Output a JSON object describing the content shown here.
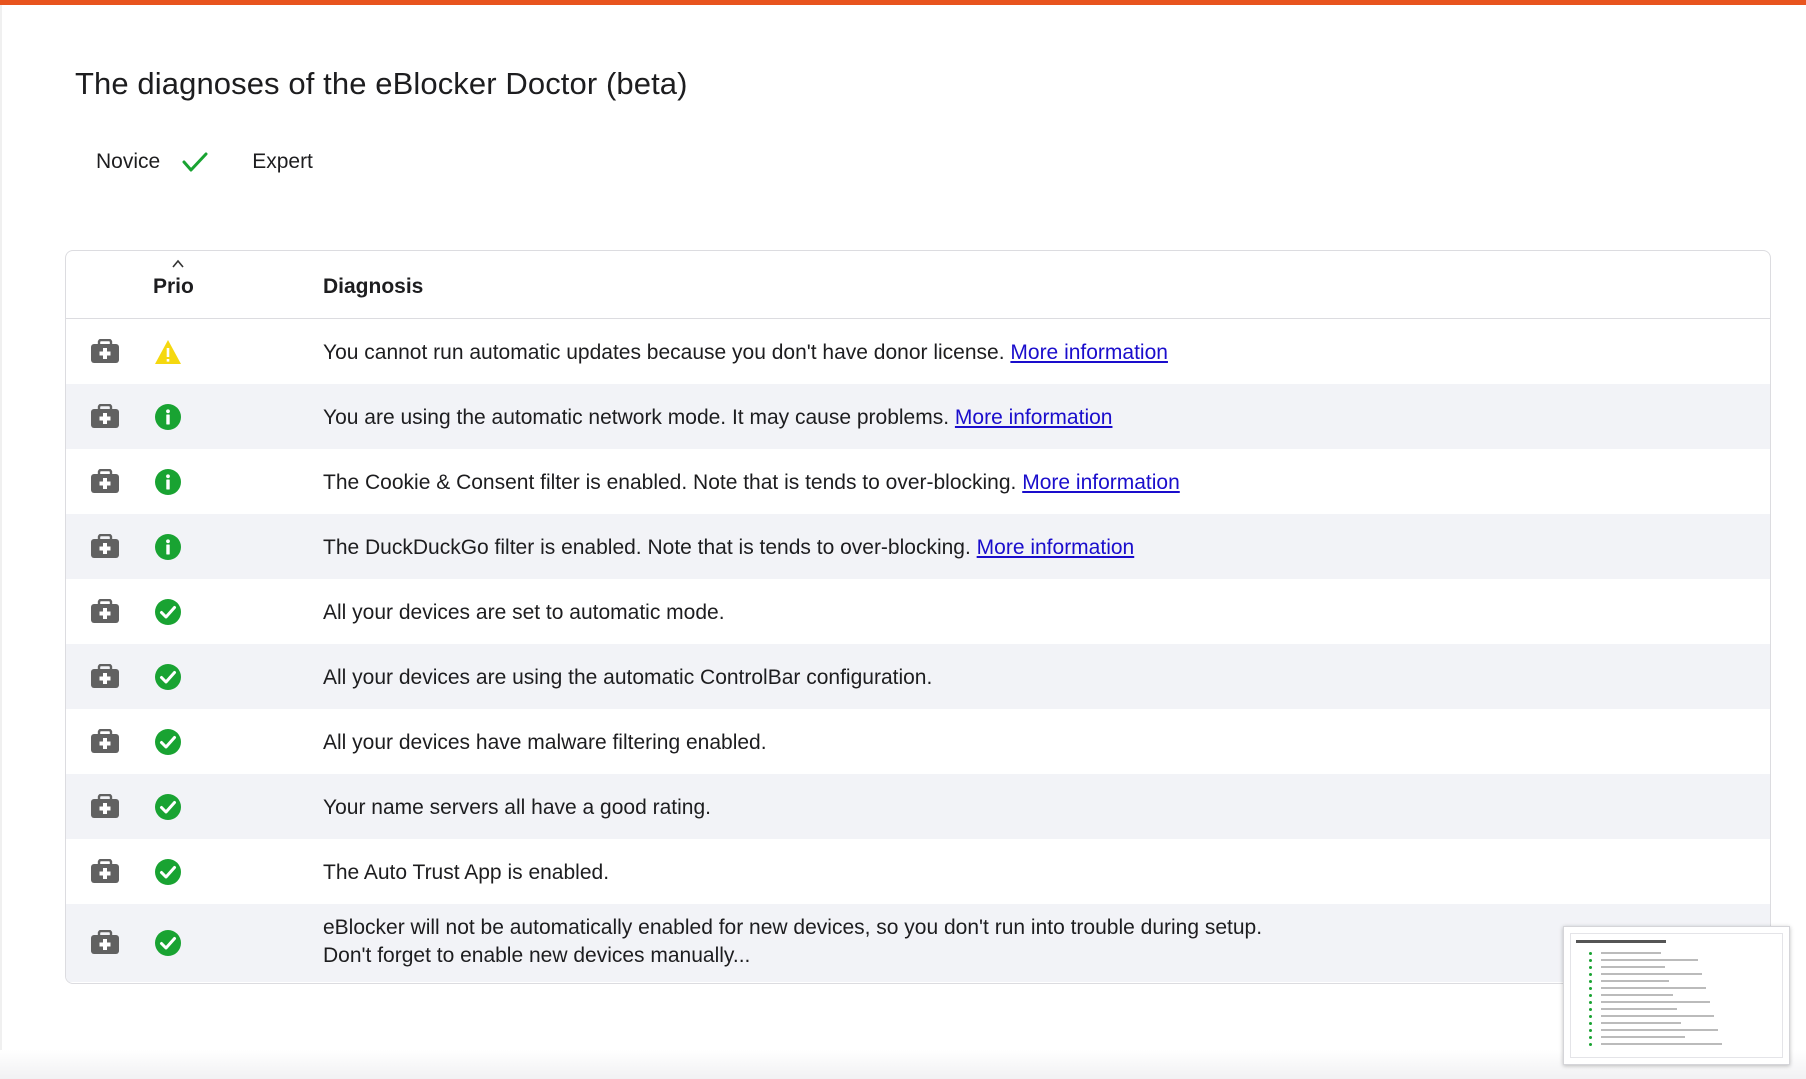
{
  "page": {
    "title": "The diagnoses of the eBlocker Doctor (beta)",
    "accent_color": "#e8541e"
  },
  "mode": {
    "novice_label": "Novice",
    "expert_label": "Expert",
    "selected": "Novice",
    "check_color": "#19a332"
  },
  "table": {
    "columns": {
      "prio": "Prio",
      "diagnosis": "Diagnosis"
    },
    "sort": {
      "column": "Prio",
      "direction": "ascending"
    },
    "rows": [
      {
        "icon": "first-aid-kit-icon",
        "prio": "warning",
        "text": "You cannot run automatic updates because you don't have donor license.",
        "link": "More information"
      },
      {
        "icon": "first-aid-kit-icon",
        "prio": "info",
        "text": "You are using the automatic network mode. It may cause problems.",
        "link": "More information"
      },
      {
        "icon": "first-aid-kit-icon",
        "prio": "info",
        "text": "The Cookie & Consent filter is enabled. Note that is tends to over-blocking.",
        "link": "More information"
      },
      {
        "icon": "first-aid-kit-icon",
        "prio": "info",
        "text": "The DuckDuckGo filter is enabled. Note that is tends to over-blocking.",
        "link": "More information"
      },
      {
        "icon": "first-aid-kit-icon",
        "prio": "ok",
        "text": "All your devices are set to automatic mode.",
        "link": ""
      },
      {
        "icon": "first-aid-kit-icon",
        "prio": "ok",
        "text": "All your devices are using the automatic ControlBar configuration.",
        "link": ""
      },
      {
        "icon": "first-aid-kit-icon",
        "prio": "ok",
        "text": "All your devices have malware filtering enabled.",
        "link": ""
      },
      {
        "icon": "first-aid-kit-icon",
        "prio": "ok",
        "text": "Your name servers all have a good rating.",
        "link": ""
      },
      {
        "icon": "first-aid-kit-icon",
        "prio": "ok",
        "text": "The Auto Trust App is enabled.",
        "link": ""
      },
      {
        "icon": "first-aid-kit-icon",
        "prio": "ok",
        "text": "eBlocker will not be automatically enabled for new devices, so you don't run into trouble during setup. Don't forget to enable new devices manually...",
        "link": ""
      }
    ]
  },
  "colors": {
    "warning": "#f5d80f",
    "info": "#19a332",
    "ok": "#19a332",
    "kit": "#616161",
    "link": "#1a0dcc"
  }
}
